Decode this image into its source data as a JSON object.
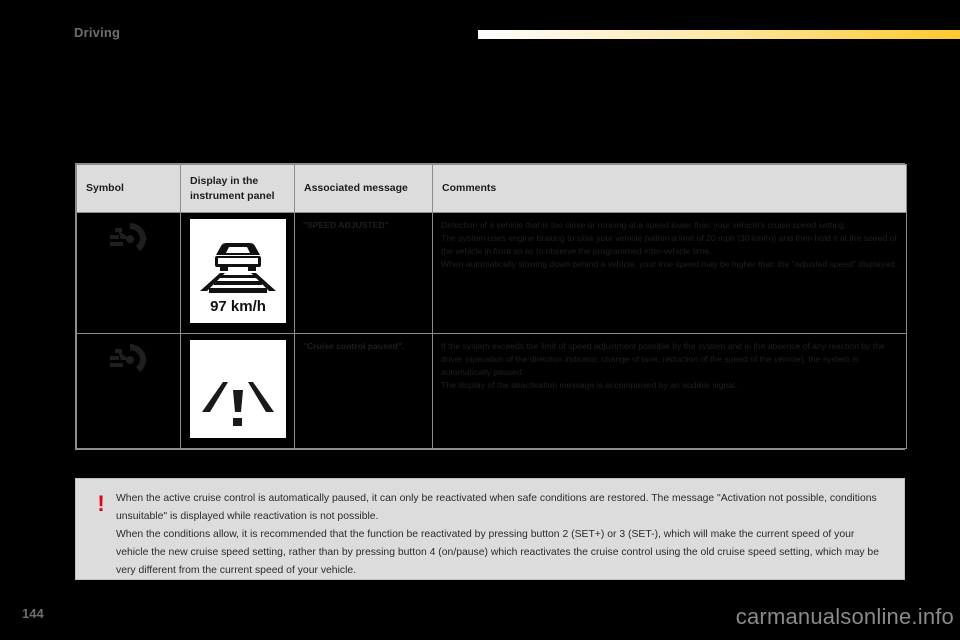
{
  "header": {
    "section_title": "Driving",
    "rule_gradient_from": "#ffffff",
    "rule_gradient_to": "#fdc82f"
  },
  "table": {
    "columns": [
      {
        "label": "Symbol",
        "name": "symbol"
      },
      {
        "label": "Display in the instrument panel",
        "name": "display-in-the-instrument-panel"
      },
      {
        "label": "Associated message",
        "name": "associated-message"
      },
      {
        "label": "Comments",
        "name": "comments"
      }
    ],
    "rows": [
      {
        "symbol_icon": "cruise-control-gauge-icon",
        "display_icon": "speed-adjusted-panel-icon",
        "display_speed": "97 km/h",
        "message": "\"SPEED ADJUSTED\"",
        "comments": [
          "Detection of a vehicle that is too close or running at a speed lower than your vehicle's cruise speed setting.",
          "The system uses engine braking to slow your vehicle (within a limit of 20 mph (30 km/h)) and then hold it at the speed of the vehicle in front so as to observe the programmed inter-vehicle time.",
          "When automatically slowing down behind a vehicle, your true speed may be higher than the \"adjusted speed\" displayed."
        ]
      },
      {
        "symbol_icon": "cruise-control-gauge-icon",
        "display_icon": "cruise-control-paused-panel-icon",
        "display_speed": "",
        "message": "\"Cruise control paused\".",
        "comments": [
          "If the system exceeds the limit of speed adjustment possible by the system and in the absence of any reaction by the driver (operation of the direction indicator, change of lane, reduction of the speed of the vehicle), the system is automatically paused.",
          "The display of the deactivation message is accompanied by an audible signal."
        ]
      }
    ]
  },
  "note": {
    "icon": "warning-exclamation-icon",
    "icon_color": "#e2001a",
    "glyph": "!",
    "paragraphs": [
      "When the active cruise control is automatically paused, it can only be reactivated when safe conditions are restored. The message \"Activation not possible, conditions unsuitable\" is displayed while reactivation is not possible.",
      "When the conditions allow, it is recommended that the function be reactivated by pressing button 2 (SET+) or 3 (SET-), which will make the current speed of your vehicle the new cruise speed setting, rather than by pressing button 4 (on/pause) which reactivates the cruise control using the old cruise speed setting, which may be very different from the current speed of your vehicle."
    ]
  },
  "footer": {
    "page_number": "144",
    "watermark": "carmanualsonline.info"
  }
}
